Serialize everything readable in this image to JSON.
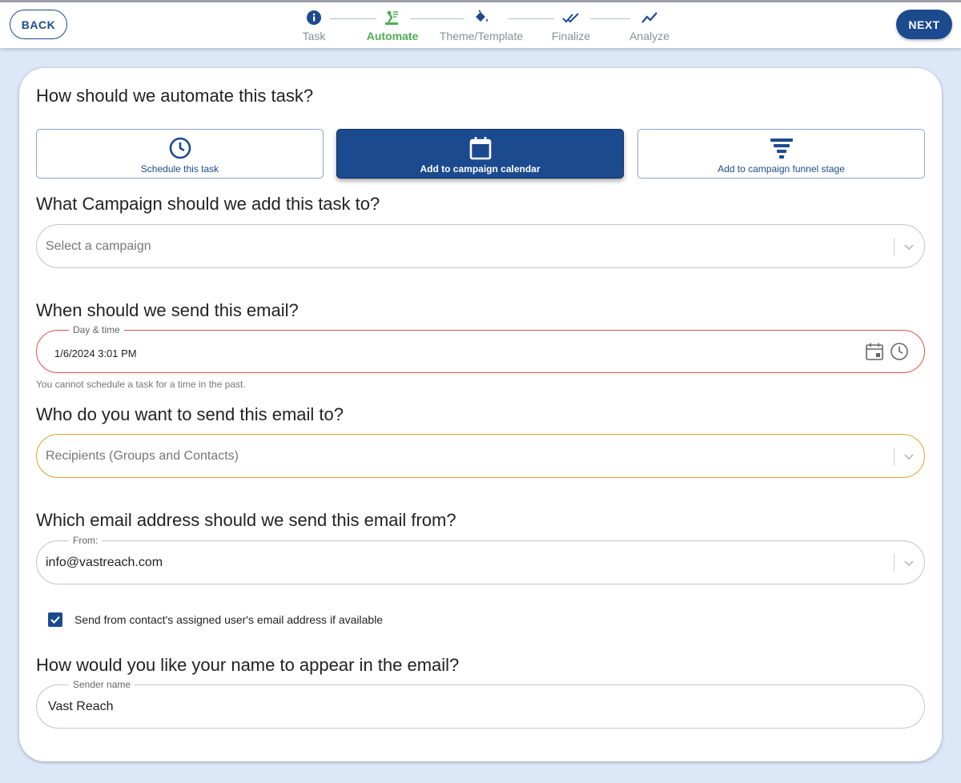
{
  "header": {
    "back_label": "BACK",
    "next_label": "NEXT",
    "steps": [
      {
        "label": "Task",
        "icon": "info-icon"
      },
      {
        "label": "Automate",
        "icon": "automation-icon"
      },
      {
        "label": "Theme/Template",
        "icon": "paint-bucket-icon"
      },
      {
        "label": "Finalize",
        "icon": "double-check-icon"
      },
      {
        "label": "Analyze",
        "icon": "trend-line-icon"
      }
    ],
    "active_step": "Automate"
  },
  "automate": {
    "question": "How should we automate this task?",
    "options": [
      {
        "label": "Schedule this task",
        "icon": "clock-icon"
      },
      {
        "label": "Add to campaign calendar",
        "icon": "calendar-icon",
        "selected": true
      },
      {
        "label": "Add to campaign funnel stage",
        "icon": "funnel-icon"
      }
    ]
  },
  "campaign": {
    "question": "What Campaign should we add this task to?",
    "placeholder": "Select a campaign"
  },
  "send_time": {
    "question": "When should we send this email?",
    "legend": "Day & time",
    "value": "1/6/2024 3:01 PM",
    "error": "You cannot schedule a task for a time in the past."
  },
  "recipients": {
    "question": "Who do you want to send this email to?",
    "placeholder": "Recipients (Groups and Contacts)"
  },
  "from_address": {
    "question": "Which email address should we send this email from?",
    "legend": "From:",
    "value": "info@vastreach.com",
    "checkbox_label": "Send from contact's assigned user's email address if available",
    "checkbox_checked": true
  },
  "sender_name": {
    "question": "How would you like your name to appear in the email?",
    "legend": "Sender name",
    "value": "Vast Reach"
  },
  "colors": {
    "brand": "#1c4a8f",
    "active_step": "#4caf50",
    "error": "#d9534f",
    "warning": "#e0a030",
    "background": "#dce8f8"
  }
}
